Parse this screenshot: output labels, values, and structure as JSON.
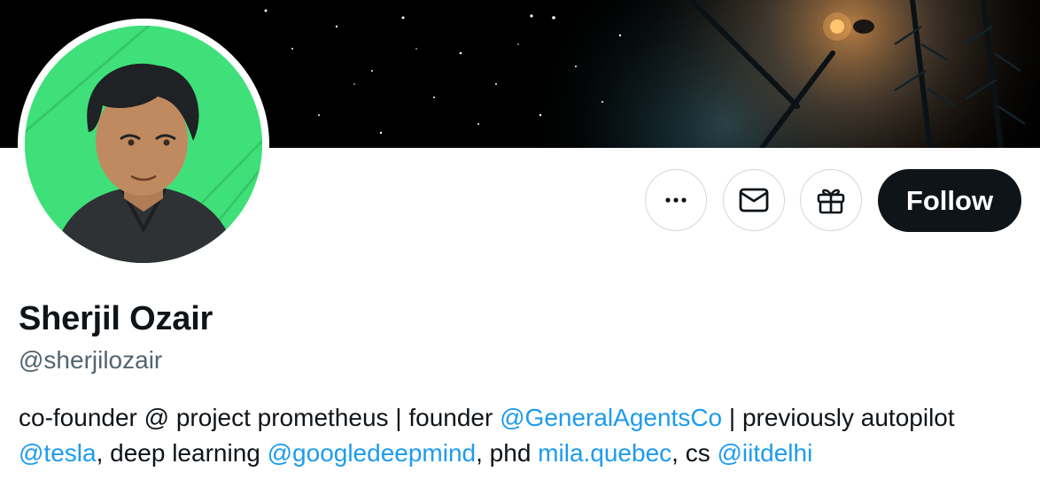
{
  "profile": {
    "display_name": "Sherjil Ozair",
    "handle": "@sherjilozair"
  },
  "actions": {
    "more_icon": "more-horizontal-icon",
    "message_icon": "envelope-icon",
    "gift_icon": "gift-icon",
    "follow_label": "Follow"
  },
  "bio": {
    "t1": "co-founder @ project prometheus | founder ",
    "link1": "@GeneralAgentsCo",
    "t2": " | previously autopilot ",
    "link2": "@tesla",
    "t3": ", deep learning ",
    "link3": "@googledeepmind",
    "t4": ", phd ",
    "link4": "mila.quebec",
    "t5": ", cs ",
    "link5": "@iitdelhi"
  },
  "colors": {
    "link": "#1d9bf0",
    "text": "#0f1419",
    "secondary": "#536471",
    "follow_bg": "#0f1419",
    "avatar_bg": "#3fe07a"
  }
}
